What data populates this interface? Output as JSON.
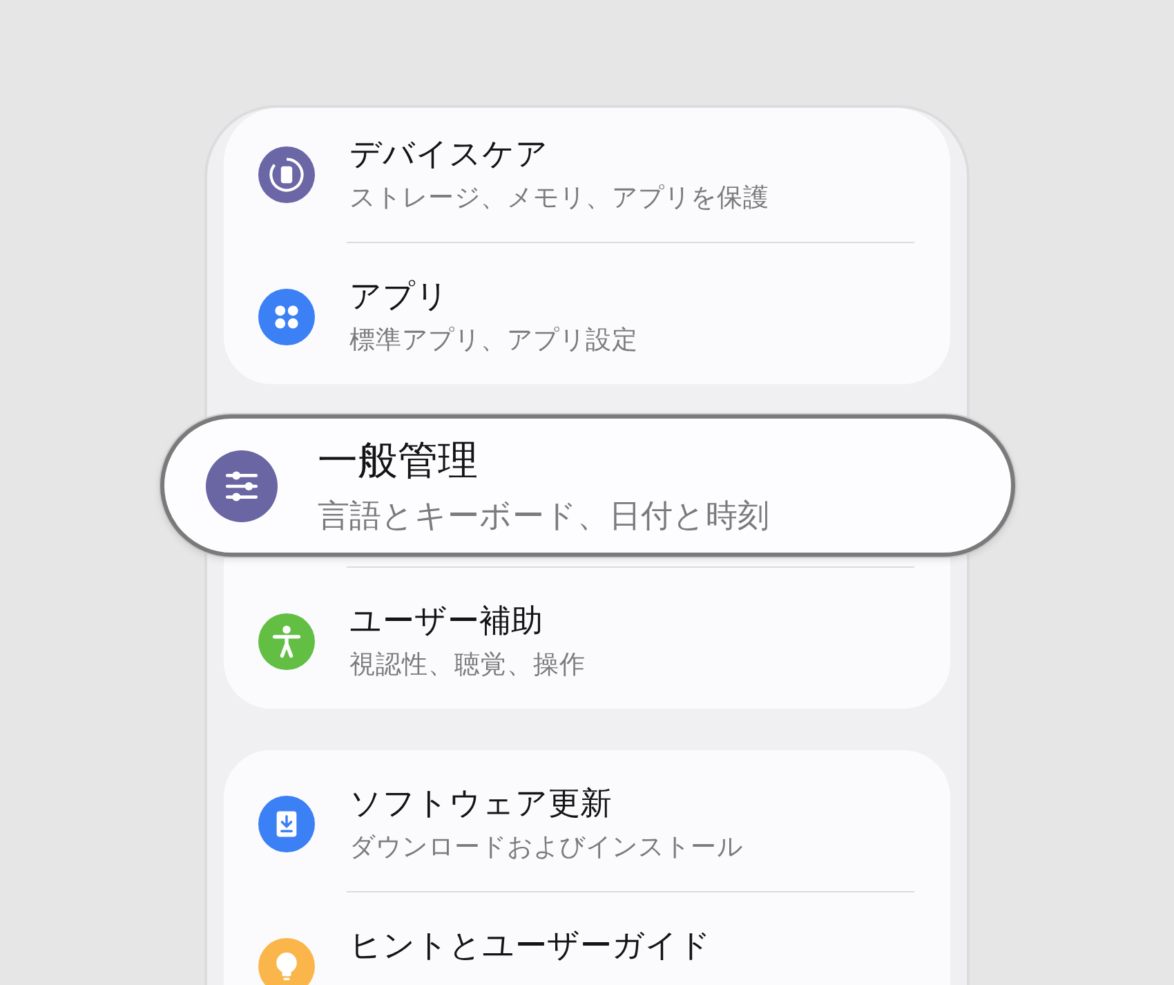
{
  "groups": [
    {
      "items": [
        {
          "kind": "ring",
          "color": "#6b66a5",
          "title": "デバイスケア",
          "subtitle": "ストレージ、メモリ、アプリを保護",
          "highlighted": false
        },
        {
          "kind": "grid",
          "color": "#3c80f5",
          "title": "アプリ",
          "subtitle": "標準アプリ、アプリ設定",
          "highlighted": false
        }
      ]
    },
    {
      "items": [
        {
          "kind": "sliders",
          "color": "#6a65a3",
          "title": "一般管理",
          "subtitle": "言語とキーボード、日付と時刻",
          "highlighted": true
        },
        {
          "kind": "figure",
          "color": "#62bf44",
          "title": "ユーザー補助",
          "subtitle": "視認性、聴覚、操作",
          "highlighted": false
        }
      ]
    },
    {
      "items": [
        {
          "kind": "download",
          "color": "#3c80f5",
          "title": "ソフトウェア更新",
          "subtitle": "ダウンロードおよびインストール",
          "highlighted": false
        },
        {
          "kind": "bulb",
          "color": "#fbb64b",
          "title": "ヒントとユーザーガイド",
          "highlighted": false
        }
      ]
    }
  ]
}
